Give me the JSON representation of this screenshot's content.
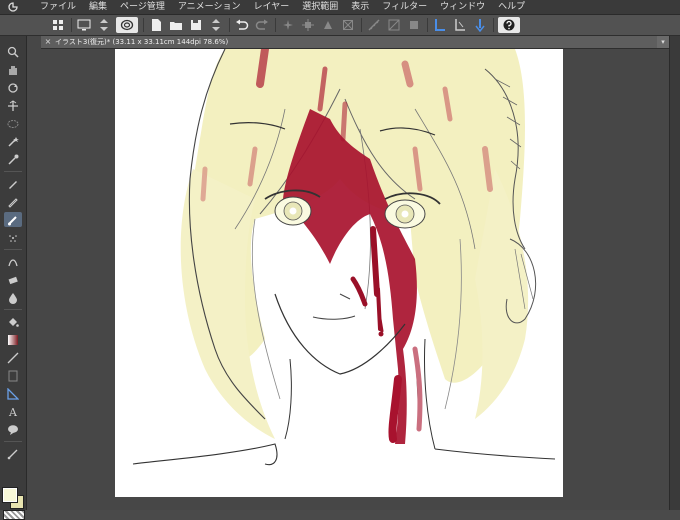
{
  "menu": {
    "logo_icon": "clip-studio-logo-icon",
    "items": [
      "ファイル",
      "編集",
      "ページ管理",
      "アニメーション",
      "レイヤー",
      "選択範囲",
      "表示",
      "フィルター",
      "ウィンドウ",
      "ヘルプ"
    ]
  },
  "document": {
    "tab_close": "×",
    "tab_title": "イラスト3(復元)* (33.11 x 33.11cm 144dpi 78.6%)",
    "tab_menu": "▾"
  },
  "colors": {
    "main_color": "#f8f8d8",
    "sub_color": "#e8e4b0",
    "hair": "#f3f0c0",
    "blood": "#a8122e",
    "accent": "#2f6fd0"
  }
}
